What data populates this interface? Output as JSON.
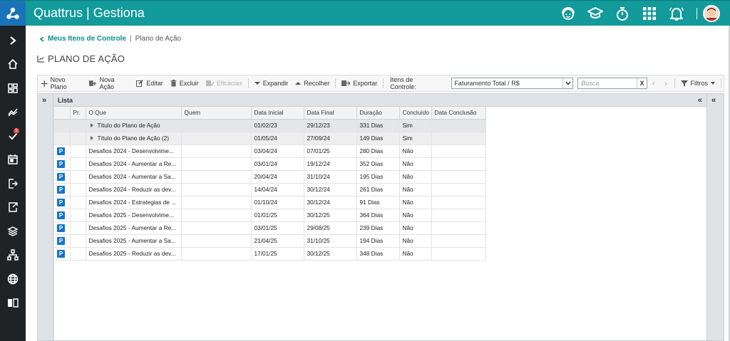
{
  "app": {
    "title": "Quattrus | Gestiona"
  },
  "topbar": {
    "icons": [
      "support-icon",
      "graduation-cap-icon",
      "stopwatch-icon",
      "apps-grid-icon",
      "bell-icon"
    ]
  },
  "sidebar": {
    "items": [
      {
        "icon": "chevron-right-icon"
      },
      {
        "icon": "home-icon"
      },
      {
        "icon": "dashboard-icon"
      },
      {
        "icon": "trend-icon"
      },
      {
        "icon": "tasks-check-icon",
        "badge": "5"
      },
      {
        "icon": "calendar-icon"
      },
      {
        "icon": "exit-icon"
      },
      {
        "icon": "export-icon"
      },
      {
        "icon": "layers-icon"
      },
      {
        "icon": "hierarchy-icon"
      },
      {
        "icon": "globe-icon"
      },
      {
        "icon": "book-icon"
      }
    ]
  },
  "breadcrumb": {
    "link": "Meus Itens de Controle",
    "sep": "|",
    "current": "Plano de Ação"
  },
  "page": {
    "title": "PLANO DE AÇÃO"
  },
  "toolbar": {
    "new_plan": "Novo Plano",
    "new_action": "Nova Ação",
    "edit": "Editar",
    "delete": "Excluir",
    "efficacies": "Eficácias",
    "expand": "Expandir",
    "collapse": "Recolher",
    "export": "Exportar",
    "control_items_label": "Itens de Controle:",
    "control_items_value": "Faturamento Total / R$",
    "search_placeholder": "Busca",
    "search_clear": "X",
    "filters": "Filtros"
  },
  "panel": {
    "title": "Lista"
  },
  "grid": {
    "columns": [
      "Pr.",
      "O Que",
      "Quem",
      "Data Inicial",
      "Data Final",
      "Duração",
      "Concluído",
      "Data Conclusão"
    ],
    "rows": [
      {
        "type": "group",
        "pr": "",
        "oque": "Título do Plano de Ação",
        "quem": "",
        "ini": "01/02/23",
        "fim": "29/12/23",
        "dur": "331 Dias",
        "conc": "Sim",
        "dconc": ""
      },
      {
        "type": "group",
        "pr": "",
        "oque": "Título do Plano de Ação (2)",
        "quem": "",
        "ini": "01/05/24",
        "fim": "27/09/24",
        "dur": "149 Dias",
        "conc": "Sim",
        "dconc": ""
      },
      {
        "type": "item",
        "pr": "P",
        "oque": "Desafios 2024 - Desenvolvime...",
        "quem": "",
        "ini": "03/04/24",
        "fim": "07/01/25",
        "dur": "280 Dias",
        "conc": "Não",
        "dconc": ""
      },
      {
        "type": "item",
        "pr": "P",
        "oque": "Desafios 2024 - Aumentar a Re...",
        "quem": "",
        "ini": "03/01/24",
        "fim": "19/12/24",
        "dur": "352 Dias",
        "conc": "Não",
        "dconc": ""
      },
      {
        "type": "item",
        "pr": "P",
        "oque": "Desafios 2024 - Aumentar a Sa...",
        "quem": "",
        "ini": "20/04/24",
        "fim": "31/10/24",
        "dur": "195 Dias",
        "conc": "Não",
        "dconc": ""
      },
      {
        "type": "item",
        "pr": "P",
        "oque": "Desafios 2024 - Reduzir as dev...",
        "quem": "",
        "ini": "14/04/24",
        "fim": "30/12/24",
        "dur": "261 Dias",
        "conc": "Não",
        "dconc": ""
      },
      {
        "type": "item",
        "pr": "P",
        "oque": "Desafios 2024 - Estrategias de ...",
        "quem": "",
        "ini": "01/10/24",
        "fim": "30/12/24",
        "dur": "91 Dias",
        "conc": "Não",
        "dconc": ""
      },
      {
        "type": "item",
        "pr": "P",
        "oque": "Desafios 2025 - Desenvolvime...",
        "quem": "",
        "ini": "01/01/25",
        "fim": "30/12/25",
        "dur": "364 Dias",
        "conc": "Não",
        "dconc": ""
      },
      {
        "type": "item",
        "pr": "P",
        "oque": "Desafios 2025 - Aumentar a Re...",
        "quem": "",
        "ini": "03/01/25",
        "fim": "29/08/25",
        "dur": "239 Dias",
        "conc": "Não",
        "dconc": ""
      },
      {
        "type": "item",
        "pr": "P",
        "oque": "Desafios 2025 - Aumentar a Sa...",
        "quem": "",
        "ini": "21/04/25",
        "fim": "31/10/25",
        "dur": "194 Dias",
        "conc": "Não",
        "dconc": ""
      },
      {
        "type": "item",
        "pr": "P",
        "oque": "Desafios 2025 - Reduzir as dev...",
        "quem": "",
        "ini": "17/01/25",
        "fim": "30/12/25",
        "dur": "348 Dias",
        "conc": "Não",
        "dconc": ""
      }
    ]
  },
  "colors": {
    "topbar": "#139a9a",
    "sidebar": "#1f2326",
    "logo": "#1a73b8",
    "accent_link": "#0f8d8d",
    "priority_badge": "#1475c8"
  }
}
